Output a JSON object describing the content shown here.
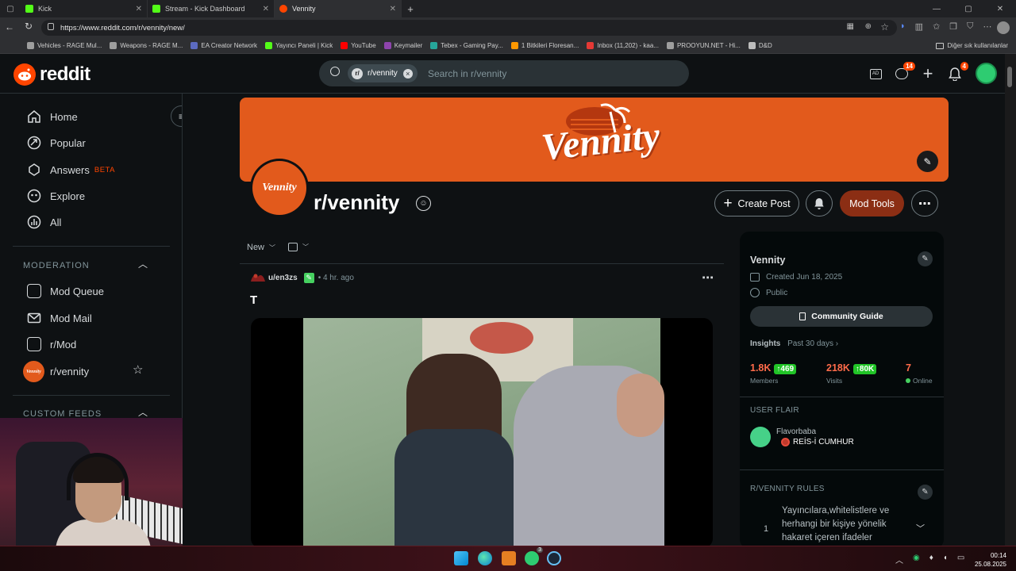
{
  "browser": {
    "tabs": [
      {
        "label": "Kick",
        "color": "#53fc18"
      },
      {
        "label": "Stream - Kick Dashboard",
        "color": "#53fc18"
      },
      {
        "label": "Vennity",
        "color": "#ff4500"
      }
    ],
    "new_tab": "+",
    "url": "https://www.reddit.com/r/vennity/new/",
    "bookmarks": [
      {
        "label": "Vehicles - RAGE Mul...",
        "color": "#9e9e9e"
      },
      {
        "label": "Weapons - RAGE M...",
        "color": "#9e9e9e"
      },
      {
        "label": "EA Creator Network",
        "color": "#5c6bc0"
      },
      {
        "label": "Yayıncı Paneli | Kick",
        "color": "#53fc18"
      },
      {
        "label": "YouTube",
        "color": "#ff0000"
      },
      {
        "label": "Keymailer",
        "color": "#8e44ad"
      },
      {
        "label": "Tebex - Gaming Pay...",
        "color": "#26a69a"
      },
      {
        "label": "1 Bitkileri Floresan...",
        "color": "#ff9800"
      },
      {
        "label": "Inbox (11,202) - kaa...",
        "color": "#e53935"
      },
      {
        "label": "PROOYUN.NET - Hi...",
        "color": "#9e9e9e"
      },
      {
        "label": "D&D",
        "color": "#bdbdbd"
      }
    ],
    "other_bookmarks": "Diğer sık kullanılanlar"
  },
  "header": {
    "logo": "reddit",
    "search_chip": "r/vennity",
    "search_placeholder": "Search in r/vennity",
    "chat_badge": "14",
    "notif_badge": "4"
  },
  "sidebar": {
    "items": [
      {
        "label": "Home"
      },
      {
        "label": "Popular"
      },
      {
        "label": "Answers",
        "tag": "BETA"
      },
      {
        "label": "Explore"
      },
      {
        "label": "All"
      }
    ],
    "moderation_title": "MODERATION",
    "moderation_items": [
      {
        "label": "Mod Queue"
      },
      {
        "label": "Mod Mail"
      },
      {
        "label": "r/Mod"
      },
      {
        "label": "r/vennity"
      }
    ],
    "custom_feeds_title": "CUSTOM FEEDS"
  },
  "community": {
    "banner_text": "Vennity",
    "avatar_text": "Vennity",
    "name": "r/vennity",
    "create_post": "Create Post",
    "mod_tools": "Mod Tools"
  },
  "feed": {
    "sort": "New",
    "post": {
      "author": "u/en3zs",
      "time": "• 4 hr. ago",
      "title": "T"
    }
  },
  "about": {
    "name": "Vennity",
    "created": "Created Jun 18, 2025",
    "visibility": "Public",
    "guide_button": "Community Guide",
    "insights_label": "Insights",
    "insights_period": "Past 30 days ›",
    "members_value": "1.8K",
    "members_delta": "↑469",
    "members_label": "Members",
    "visits_value": "218K",
    "visits_delta": "↑80K",
    "visits_label": "Visits",
    "online_value": "7",
    "online_label": "Online",
    "user_flair_title": "USER FLAIR",
    "flair_user": "Flavorbaba",
    "flair_text": "REİS-İ CUMHUR",
    "rules_title": "R/VENNITY RULES",
    "rule_number": "1",
    "rule_text": "Yayıncılara,whitelistlere ve herhangi bir kişiye yönelik hakaret içeren ifadeler"
  },
  "system": {
    "time": "00:14",
    "date": "25.08.2025",
    "xbox_badge": "3"
  },
  "colors": {
    "accent": "#ff4500",
    "banner": "#e25a1c",
    "mod_tools": "#8b2e14",
    "positive": "#21c427"
  }
}
